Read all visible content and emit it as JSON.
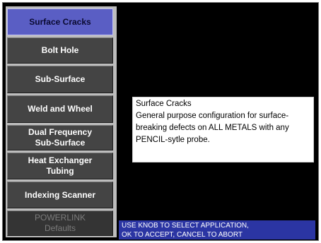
{
  "menu": {
    "items": [
      {
        "label": "Surface Cracks"
      },
      {
        "label": "Bolt Hole"
      },
      {
        "label": "Sub-Surface"
      },
      {
        "label": "Weld and Wheel"
      },
      {
        "label": "Dual Frequency\nSub-Surface"
      },
      {
        "label": "Heat Exchanger\nTubing"
      },
      {
        "label": "Indexing Scanner"
      },
      {
        "label": "POWERLINK\nDefaults"
      }
    ]
  },
  "description": {
    "title": "Surface Cracks",
    "line1": "General purpose configuration for surface-",
    "line2": "breaking defects on ALL METALS with any",
    "line3": "PENCIL-sytle probe."
  },
  "status": {
    "line1": "USE KNOB TO SELECT APPLICATION,",
    "line2": "OK TO ACCEPT, CANCEL TO ABORT"
  },
  "colors": {
    "selected": "#5a5ec4",
    "status_bar": "#2b35a3",
    "background": "#000000"
  }
}
